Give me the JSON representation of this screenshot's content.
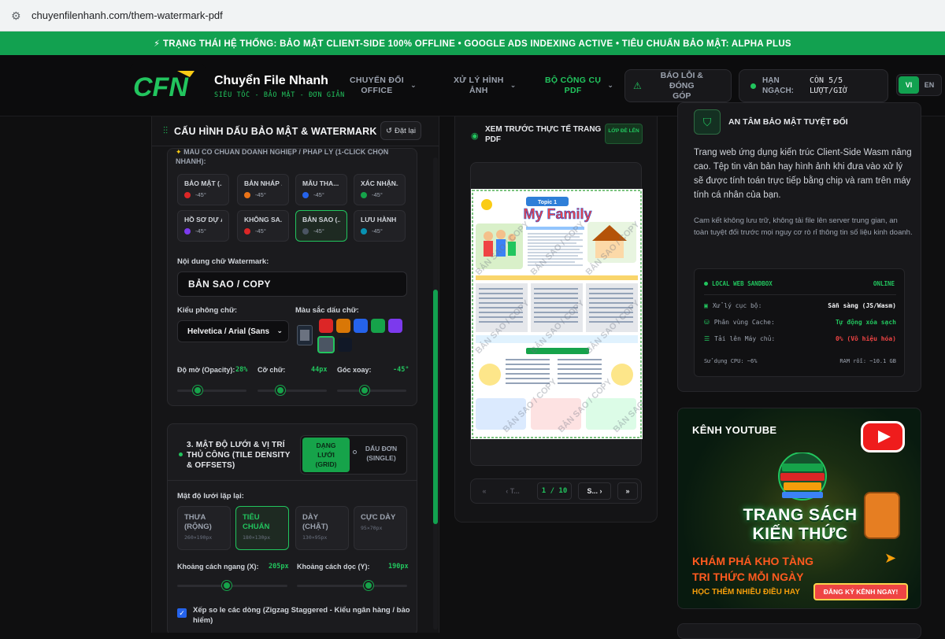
{
  "browser": {
    "url": "chuyenfilenhanh.com/them-watermark-pdf"
  },
  "status_strip": {
    "text": "⚡ TRẠNG THÁI HỆ THỐNG: BẢO MẬT CLIENT-SIDE 100% OFFLINE • GOOGLE ADS INDEXING ACTIVE • TIÊU CHUẨN BẢO MẬT: ALPHA PLUS"
  },
  "header": {
    "logo_text": "CFN",
    "brand_name": "Chuyển File Nhanh",
    "brand_tagline": "SIÊU TỐC - BẢO MẬT - ĐƠN GIẢN",
    "nav": [
      {
        "line1": "CHUYỂN ĐỔI",
        "line2": "OFFICE"
      },
      {
        "line1": "XỬ LÝ HÌNH",
        "line2": "ẢNH"
      },
      {
        "line1": "BỘ CÔNG CỤ",
        "line2": "PDF"
      }
    ],
    "report": {
      "line1": "BÁO LỖI & ĐÓNG",
      "line2": "GÓP"
    },
    "quota": {
      "label1": "HẠN",
      "label2": "NGẠCH:",
      "value1": "CÒN 5/5",
      "value2": "LƯỢT/GIỜ"
    },
    "lang": [
      "VI",
      "EN"
    ]
  },
  "config": {
    "title": "CẤU HÌNH DẤU BẢO MẬT & WATERMARK",
    "reset_label": "Đặt lại",
    "preset_cut_label": "MẪU CÓ CHUẨN DOANH NGHIỆP / PHÁP LÝ (1-CLICK CHỌN NHANH):",
    "presets": [
      {
        "name": "BẢO MẬT (...",
        "angle": "-45°",
        "color": "#dc2626"
      },
      {
        "name": "BẢN NHÁP ...",
        "angle": "-45°",
        "color": "#ea7317"
      },
      {
        "name": "MẪU THA...",
        "angle": "-45°",
        "color": "#2563eb"
      },
      {
        "name": "XÁC NHẬN...",
        "angle": "-45°",
        "color": "#16a34a"
      },
      {
        "name": "HỒ SƠ DỰ ÁN",
        "angle": "-45°",
        "color": "#7c3aed"
      },
      {
        "name": "KHÔNG SA...",
        "angle": "-45°",
        "color": "#dc2626"
      },
      {
        "name": "BẢN SAO (...",
        "angle": "-45°",
        "color": "#4b5563"
      },
      {
        "name": "LƯU HÀNH ...",
        "angle": "-45°",
        "color": "#0891b2"
      }
    ],
    "watermark_label": "Nội dung chữ Watermark:",
    "watermark_value": "BẢN SAO / COPY",
    "font_label": "Kiểu phông chữ:",
    "font_value": "Helvetica / Arial (Sans",
    "color_label": "Màu sắc dấu chữ:",
    "swatches": [
      "#dc2626",
      "#d97706",
      "#2563eb",
      "#16a34a",
      "#7c3aed",
      "#4b5563",
      "#111827"
    ],
    "opacity_label": "Độ mờ (Opacity):",
    "opacity_value": "28%",
    "opacity_fraction": 0.28,
    "size_label": "Cỡ chữ:",
    "size_value": "44px",
    "rotation_label": "Góc xoay:",
    "rotation_value": "-45°",
    "grid_section_title": "3. MẬT ĐỘ LƯỚI & VỊ TRÍ THỦ CÔNG (TILE DENSITY & OFFSETS)",
    "mode_grid": {
      "line1": "DẠNG",
      "line2": "LƯỚI",
      "line3": "(GRID)"
    },
    "mode_single": {
      "line1": "DẤU ĐƠN",
      "line2": "(SINGLE)"
    },
    "density_label": "Mật độ lưới lặp lại:",
    "densities": [
      {
        "l1": "THƯA",
        "l2": "(RỘNG)",
        "size": "260×190px"
      },
      {
        "l1": "TIÊU",
        "l2": "CHUẨN",
        "size": "180×130px"
      },
      {
        "l1": "DÀY",
        "l2": "(CHẬT)",
        "size": "130×95px"
      },
      {
        "l1": "CỰC DÀY",
        "l2": "",
        "size": "95×70px"
      }
    ],
    "hspace_label": "Khoảng cách ngang (X):",
    "hspace_value": "205px",
    "vspace_label": "Khoảng cách dọc (Y):",
    "vspace_value": "190px",
    "stagger_label": "Xếp so le các dòng (Zigzag Staggered - Kiểu ngân hàng / bảo hiểm)"
  },
  "preview": {
    "title": "XEM TRƯỚC THỰC TẾ TRANG PDF",
    "badge": "LỚP ĐÈ LÊN",
    "doc_topic": "Topic 1",
    "doc_title": "My Family",
    "watermark_text": "BẢN SAO / COPY",
    "pager": {
      "first": "«",
      "prev": "‹ T...",
      "count": "1 / 10",
      "next": "S... ›",
      "last": "»"
    }
  },
  "security": {
    "title": "AN TÂM BẢO MẬT TUYỆT ĐỐI",
    "p1": "Trang web ứng dụng kiến trúc Client-Side Wasm nâng cao. Tệp tin văn bản hay hình ảnh khi đưa vào xử lý sẽ được tính toán trực tiếp bằng chip và ram trên máy tính cá nhân của bạn.",
    "p2": "Cam kết không lưu trữ, không tải file lên server trung gian, an toàn tuyệt đối trước mọi nguy cơ rò rỉ thông tin số liệu kinh doanh.",
    "sandbox_title": "LOCAL WEB SANDBOX",
    "sandbox_status": "ONLINE",
    "rows": [
      {
        "k": "Xử lý cục bộ:",
        "v": "Sẵn sàng (JS/Wasm)",
        "color": "#f3f4f6"
      },
      {
        "k": "Phân vùng Cache:",
        "v": "Tự động xóa sạch",
        "color": "#22c55e"
      },
      {
        "k": "Tải lên Máy chủ:",
        "v": "0% (Vô hiệu hóa)",
        "color": "#ef4444"
      }
    ],
    "cpu": "Sử dụng CPU: ~6%",
    "ram": "RAM rỗi: ~10.1 GB"
  },
  "promo": {
    "channel": "KÊNH YOUTUBE",
    "big1": "TRANG SÁCH",
    "big2": "KIẾN THỨC",
    "sub1": "KHÁM PHÁ KHO TÀNG",
    "sub2": "TRI THỨC MỖI NGÀY",
    "sub3": "HỌC THÊM NHIỀU ĐIỀU HAY",
    "cta": "ĐĂNG KÝ KÊNH NGAY!"
  }
}
